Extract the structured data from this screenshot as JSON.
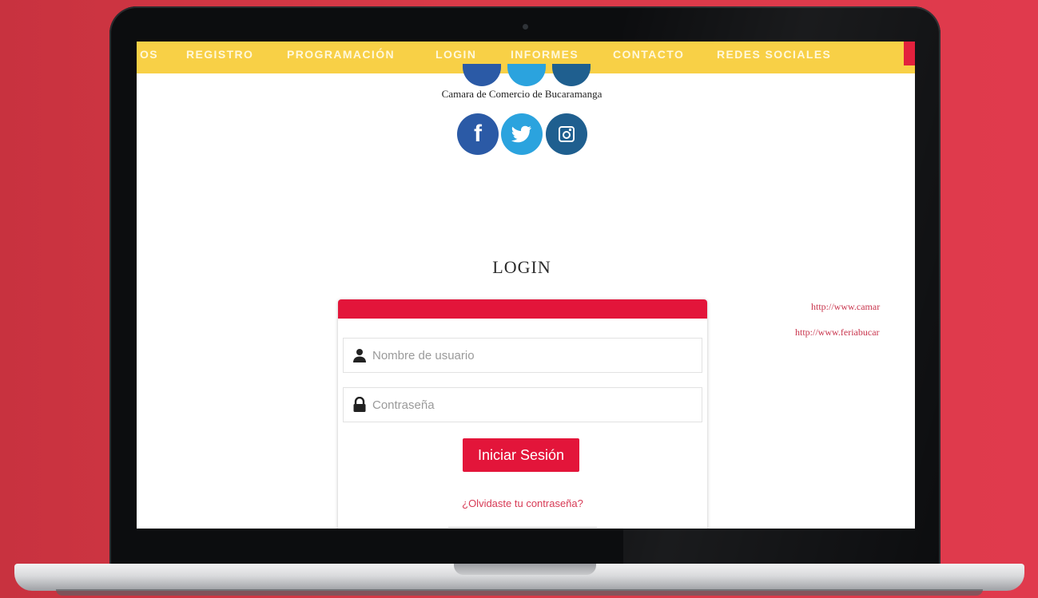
{
  "nav": {
    "items": [
      "OS",
      "REGISTRO",
      "PROGRAMACIÓN",
      "LOGIN",
      "INFORMES",
      "CONTACTO",
      "REDES SOCIALES"
    ]
  },
  "org": {
    "name": "Camara de Comercio de Bucaramanga"
  },
  "social": [
    {
      "icon": "facebook-icon",
      "glyph": "f",
      "color": "#2b5aa6"
    },
    {
      "icon": "twitter-icon",
      "glyph": "t",
      "color": "#2ba3de"
    },
    {
      "icon": "instagram-icon",
      "glyph": "◙",
      "color": "#1f5f8f"
    }
  ],
  "login": {
    "title": "LOGIN",
    "username_placeholder": "Nombre de usuario",
    "password_placeholder": "Contraseña",
    "submit_label": "Iniciar Sesión",
    "forgot_label": "¿Olvidaste tu contraseña?"
  },
  "side_links": [
    "http://www.camar",
    "http://www.feriabucar"
  ],
  "colors": {
    "nav_bg": "#f8d046",
    "accent_red": "#e3153a",
    "background": "#d93a48"
  }
}
